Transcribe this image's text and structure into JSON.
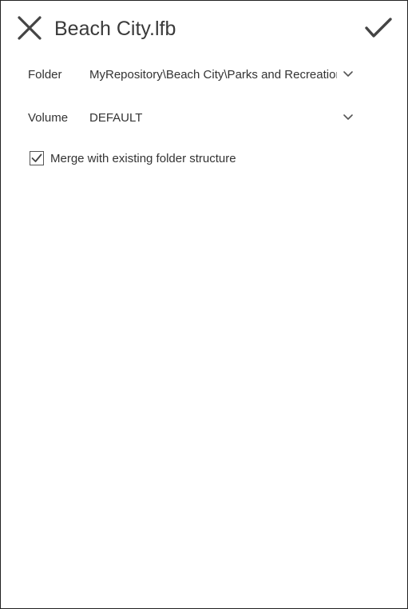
{
  "dialog": {
    "title": "Beach City.lfb",
    "close_icon": "close-icon",
    "confirm_icon": "checkmark-icon"
  },
  "fields": {
    "folder": {
      "label": "Folder",
      "value": "MyRepository\\Beach City\\Parks and Recreation"
    },
    "volume": {
      "label": "Volume",
      "value": "DEFAULT"
    }
  },
  "merge_option": {
    "label": "Merge with existing folder structure",
    "checked": true
  },
  "colors": {
    "text": "#333333",
    "icon": "#444444",
    "border": "#222222",
    "background": "#ffffff"
  }
}
